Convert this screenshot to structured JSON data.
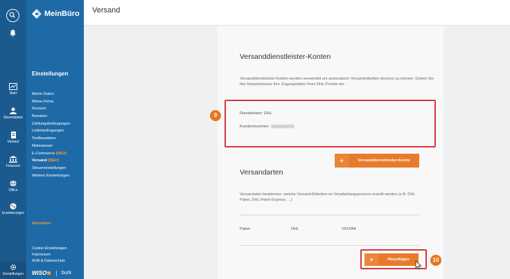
{
  "app": {
    "logo_text": "MeinBüro"
  },
  "rail": {
    "items": [
      {
        "label": "Start",
        "icon": "dashboard-icon"
      },
      {
        "label": "Stammdaten",
        "icon": "contacts-icon"
      },
      {
        "label": "Verkauf",
        "icon": "document-icon"
      },
      {
        "label": "Finanzen",
        "icon": "bank-icon"
      },
      {
        "label": "Office",
        "icon": "globe-icon"
      },
      {
        "label": "Erweiterungen",
        "icon": "extensions-icon"
      }
    ],
    "bottom_label": "Einstellungen"
  },
  "sidebar": {
    "heading": "Einstellungen",
    "items": [
      {
        "label": "Meine Daten",
        "tag": ""
      },
      {
        "label": "Meine Firma",
        "tag": ""
      },
      {
        "label": "Account",
        "tag": ""
      },
      {
        "label": "Benutzer",
        "tag": ""
      },
      {
        "label": "Zahlungsbedingungen",
        "tag": ""
      },
      {
        "label": "Lieferbedingungen",
        "tag": ""
      },
      {
        "label": "Textbausteine",
        "tag": ""
      },
      {
        "label": "Mahnwesen",
        "tag": ""
      },
      {
        "label": "E-Commerce",
        "tag": "(NEU)"
      },
      {
        "label": "Versand",
        "tag": "(NEU)"
      },
      {
        "label": "Steuereinstellungen",
        "tag": ""
      },
      {
        "label": "Weitere Einstellungen",
        "tag": ""
      }
    ],
    "logout": "Abmelden",
    "footer": [
      "Cookie Einstellungen",
      "Impressum",
      "AGB & Datenschutz"
    ],
    "brand": {
      "wiso": "WISO",
      "buhl": ":buhl"
    }
  },
  "page": {
    "title": "Versand"
  },
  "konten": {
    "title": "Versanddienstleister-Konten",
    "description": "Versanddienstleister-Konten werden verwendet um automatisch Versandetiketten drucken zu können. Geben Sie hier beispielsweise Ihre Zugangsdaten Ihres DHL-Portals ein.",
    "provider_line": "Dienstleister: DHL",
    "customer_label": "Kundennummer:",
    "add_button": "Versanddienstleister-Konto",
    "marker": "9"
  },
  "versandarten": {
    "title": "Versandarten",
    "description": "Versandaten bestimmen, welche Versand-Etiketten im Verarbeitungsprozess erstellt werden (z.B. DHL Paket, DHL Paket Express, ...)",
    "row": [
      "Paket",
      "DHL",
      "V01PAK"
    ],
    "add_button": "Hinzufügen",
    "marker": "10"
  },
  "colors": {
    "rail": "#1a5a8f",
    "sidebar": "#1e6aa7",
    "accent": "#e87b2a",
    "highlight": "#d8353e"
  }
}
